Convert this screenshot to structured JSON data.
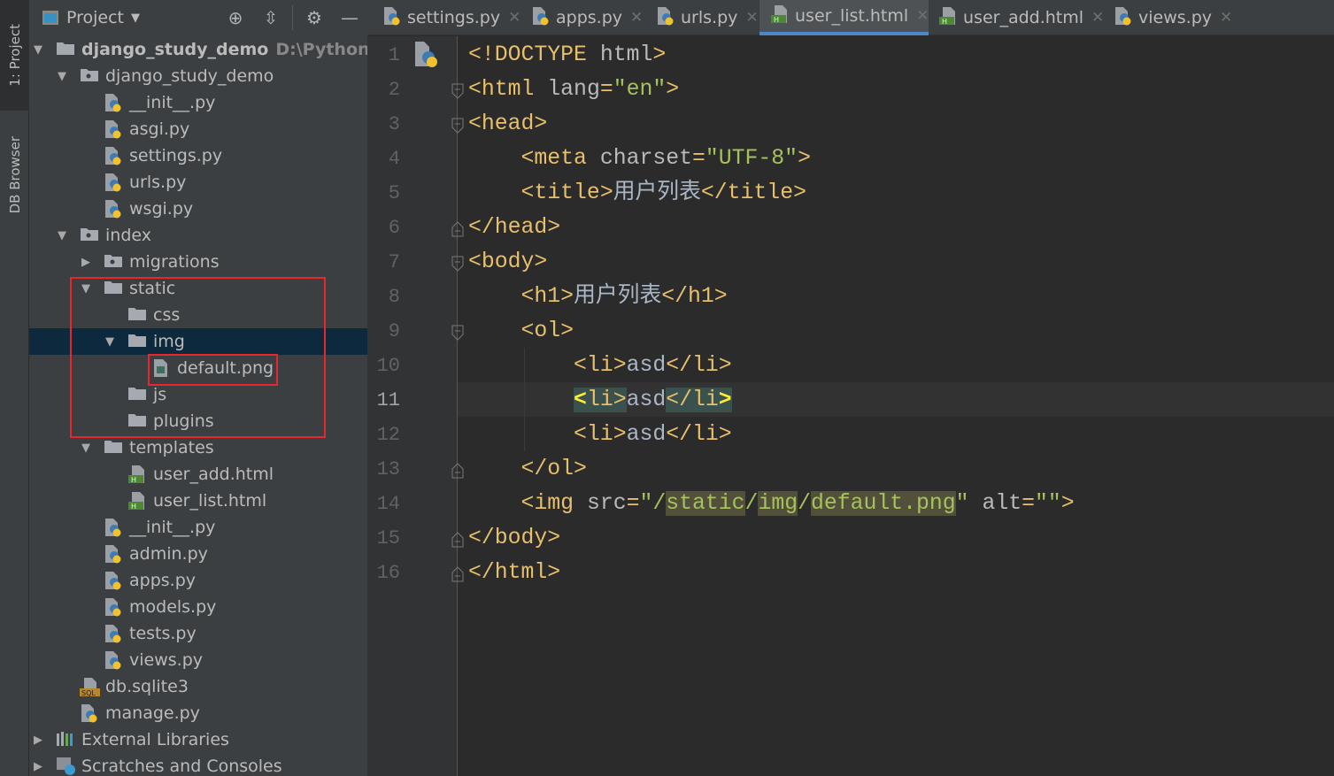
{
  "toolstrip": {
    "tabs": [
      {
        "label": "1: Project",
        "active": true
      },
      {
        "label": "DB Browser",
        "active": false
      }
    ]
  },
  "project": {
    "title": "Project",
    "header_icons": [
      "locate-icon",
      "collapse-all-icon",
      "gear-icon",
      "minimize-icon"
    ],
    "tree": [
      {
        "level": 0,
        "name": "django_study_demo",
        "path": "D:\\Python_Proje",
        "icon": "folder",
        "arrow": "down",
        "bold": true
      },
      {
        "level": 1,
        "name": "django_study_demo",
        "icon": "package",
        "arrow": "down"
      },
      {
        "level": 2,
        "name": "__init__.py",
        "icon": "python"
      },
      {
        "level": 2,
        "name": "asgi.py",
        "icon": "python"
      },
      {
        "level": 2,
        "name": "settings.py",
        "icon": "python"
      },
      {
        "level": 2,
        "name": "urls.py",
        "icon": "python"
      },
      {
        "level": 2,
        "name": "wsgi.py",
        "icon": "python"
      },
      {
        "level": 1,
        "name": "index",
        "icon": "package",
        "arrow": "down"
      },
      {
        "level": 2,
        "name": "migrations",
        "icon": "package",
        "arrow": "right"
      },
      {
        "level": 2,
        "name": "static",
        "icon": "folder",
        "arrow": "down"
      },
      {
        "level": 3,
        "name": "css",
        "icon": "folder"
      },
      {
        "level": 3,
        "name": "img",
        "icon": "folder",
        "arrow": "down",
        "selected": true
      },
      {
        "level": 4,
        "name": "default.png",
        "icon": "image"
      },
      {
        "level": 3,
        "name": "js",
        "icon": "folder"
      },
      {
        "level": 3,
        "name": "plugins",
        "icon": "folder"
      },
      {
        "level": 2,
        "name": "templates",
        "icon": "folder",
        "arrow": "down"
      },
      {
        "level": 3,
        "name": "user_add.html",
        "icon": "html"
      },
      {
        "level": 3,
        "name": "user_list.html",
        "icon": "html"
      },
      {
        "level": 2,
        "name": "__init__.py",
        "icon": "python"
      },
      {
        "level": 2,
        "name": "admin.py",
        "icon": "python"
      },
      {
        "level": 2,
        "name": "apps.py",
        "icon": "python"
      },
      {
        "level": 2,
        "name": "models.py",
        "icon": "python"
      },
      {
        "level": 2,
        "name": "tests.py",
        "icon": "python"
      },
      {
        "level": 2,
        "name": "views.py",
        "icon": "python"
      },
      {
        "level": 1,
        "name": "db.sqlite3",
        "icon": "sql"
      },
      {
        "level": 1,
        "name": "manage.py",
        "icon": "python"
      },
      {
        "level": 0,
        "name": "External Libraries",
        "icon": "libraries",
        "arrow": "right"
      },
      {
        "level": 0,
        "name": "Scratches and Consoles",
        "icon": "scratches",
        "arrow": "right"
      }
    ]
  },
  "tabs": [
    {
      "label": "settings.py",
      "icon": "python"
    },
    {
      "label": "apps.py",
      "icon": "python"
    },
    {
      "label": "urls.py",
      "icon": "python"
    },
    {
      "label": "user_list.html",
      "icon": "html",
      "active": true
    },
    {
      "label": "user_add.html",
      "icon": "html"
    },
    {
      "label": "views.py",
      "icon": "python"
    }
  ],
  "editor": {
    "current_line": 11,
    "lines": [
      {
        "n": "1",
        "fold": "",
        "tokens": [
          [
            "tag",
            "<!DOCTYPE "
          ],
          [
            "att",
            "html"
          ],
          [
            "tag",
            ">"
          ]
        ]
      },
      {
        "n": "2",
        "fold": "open",
        "tokens": [
          [
            "tag",
            "<html "
          ],
          [
            "att",
            "lang"
          ],
          [
            "tag",
            "="
          ],
          [
            "str",
            "\"en\""
          ],
          [
            "tag",
            ">"
          ]
        ]
      },
      {
        "n": "3",
        "fold": "open",
        "tokens": [
          [
            "tag",
            "<head>"
          ]
        ]
      },
      {
        "n": "4",
        "fold": "",
        "tokens": [
          [
            "txt",
            "    "
          ],
          [
            "tag",
            "<meta "
          ],
          [
            "att",
            "charset"
          ],
          [
            "tag",
            "="
          ],
          [
            "str",
            "\"UTF-8\""
          ],
          [
            "tag",
            ">"
          ]
        ]
      },
      {
        "n": "5",
        "fold": "",
        "tokens": [
          [
            "txt",
            "    "
          ],
          [
            "tag",
            "<title>"
          ],
          [
            "txt",
            "用户列表"
          ],
          [
            "tag",
            "</title>"
          ]
        ]
      },
      {
        "n": "6",
        "fold": "close",
        "tokens": [
          [
            "tag",
            "</head>"
          ]
        ]
      },
      {
        "n": "7",
        "fold": "open",
        "tokens": [
          [
            "tag",
            "<body>"
          ]
        ]
      },
      {
        "n": "8",
        "fold": "",
        "tokens": [
          [
            "txt",
            "    "
          ],
          [
            "tag",
            "<h1>"
          ],
          [
            "txt",
            "用户列表"
          ],
          [
            "tag",
            "</h1>"
          ]
        ]
      },
      {
        "n": "9",
        "fold": "open",
        "tokens": [
          [
            "txt",
            "    "
          ],
          [
            "tag",
            "<ol>"
          ]
        ]
      },
      {
        "n": "10",
        "fold": "",
        "tokens": [
          [
            "txt",
            "        "
          ],
          [
            "tag",
            "<li>"
          ],
          [
            "txt",
            "asd"
          ],
          [
            "tag",
            "</li>"
          ]
        ]
      },
      {
        "n": "11",
        "fold": "",
        "tokens": [
          [
            "txt",
            "        "
          ],
          [
            "mtb",
            "<"
          ],
          [
            "mt",
            "li>"
          ],
          [
            "txt",
            "asd"
          ],
          [
            "mt",
            "</li"
          ],
          [
            "mtb",
            ">"
          ]
        ]
      },
      {
        "n": "12",
        "fold": "",
        "tokens": [
          [
            "txt",
            "        "
          ],
          [
            "tag",
            "<li>"
          ],
          [
            "txt",
            "asd"
          ],
          [
            "tag",
            "</li>"
          ]
        ]
      },
      {
        "n": "13",
        "fold": "close",
        "tokens": [
          [
            "txt",
            "    "
          ],
          [
            "tag",
            "</ol>"
          ]
        ]
      },
      {
        "n": "14",
        "fold": "",
        "tokens": [
          [
            "txt",
            "    "
          ],
          [
            "tag",
            "<img "
          ],
          [
            "att",
            "src"
          ],
          [
            "tag",
            "="
          ],
          [
            "str",
            "\"/"
          ],
          [
            "str hl",
            "static"
          ],
          [
            "str",
            "/"
          ],
          [
            "str hl",
            "img"
          ],
          [
            "str",
            "/"
          ],
          [
            "str hl",
            "default.png"
          ],
          [
            "str",
            "\""
          ],
          [
            "att",
            " alt"
          ],
          [
            "tag",
            "="
          ],
          [
            "str",
            "\"\""
          ],
          [
            "tag",
            ">"
          ]
        ]
      },
      {
        "n": "15",
        "fold": "close",
        "tokens": [
          [
            "tag",
            "</body>"
          ]
        ]
      },
      {
        "n": "16",
        "fold": "close",
        "tokens": [
          [
            "tag",
            "</html>"
          ]
        ]
      }
    ]
  },
  "colors": {
    "accent": "#4a88c7",
    "highlight_box": "#e8262b",
    "selection": "#0d293e"
  }
}
